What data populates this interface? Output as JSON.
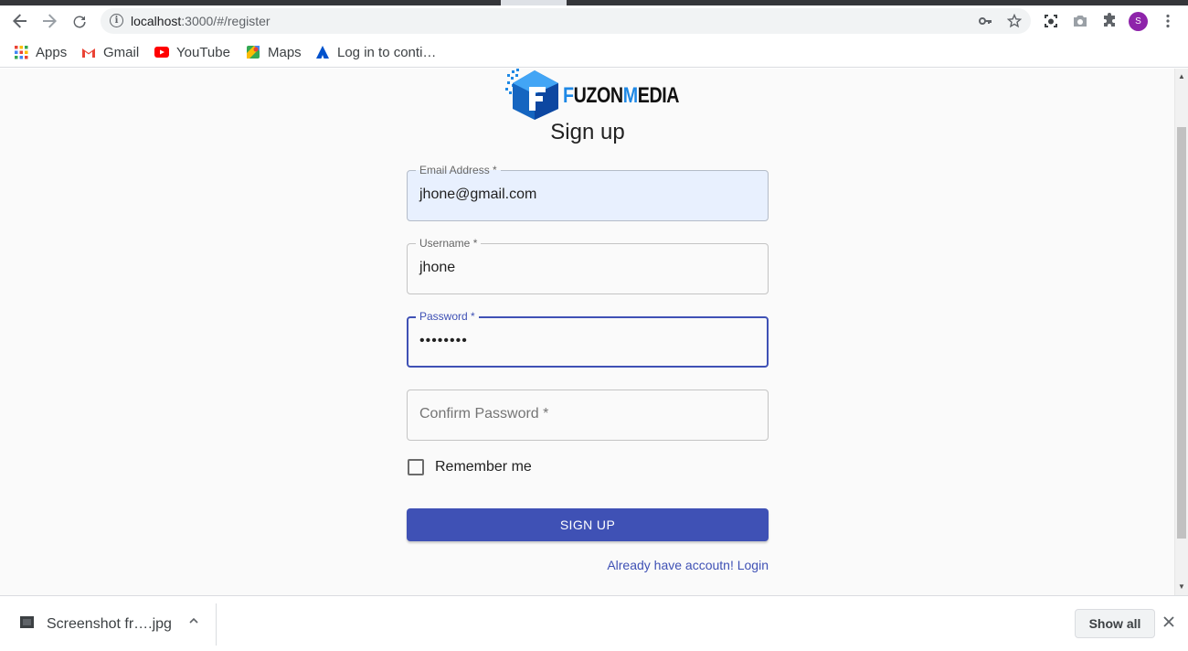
{
  "browser": {
    "url_host": "localhost",
    "url_path": ":3000/#/register",
    "avatar_letter": "S"
  },
  "bookmarks": [
    {
      "label": "Apps",
      "icon": "apps-grid-icon"
    },
    {
      "label": "Gmail",
      "icon": "gmail-icon"
    },
    {
      "label": "YouTube",
      "icon": "youtube-icon"
    },
    {
      "label": "Maps",
      "icon": "maps-icon"
    },
    {
      "label": "Log in to conti…",
      "icon": "atlassian-icon"
    }
  ],
  "page": {
    "brand": "FuzonMedia",
    "title": "Sign up",
    "fields": {
      "email": {
        "label": "Email Address *",
        "value": "jhone@gmail.com"
      },
      "username": {
        "label": "Username *",
        "value": "jhone"
      },
      "password": {
        "label": "Password *",
        "value": "••••••••"
      },
      "confirm": {
        "placeholder": "Confirm Password *"
      }
    },
    "remember_label": "Remember me",
    "signup_label": "SIGN UP",
    "login_link": "Already have accoutn! Login"
  },
  "shelf": {
    "file_name": "Screenshot fr….jpg",
    "show_all": "Show all"
  },
  "colors": {
    "primary": "#3f51b5",
    "autofill_bg": "#e8f0fe",
    "avatar": "#8e24aa"
  }
}
